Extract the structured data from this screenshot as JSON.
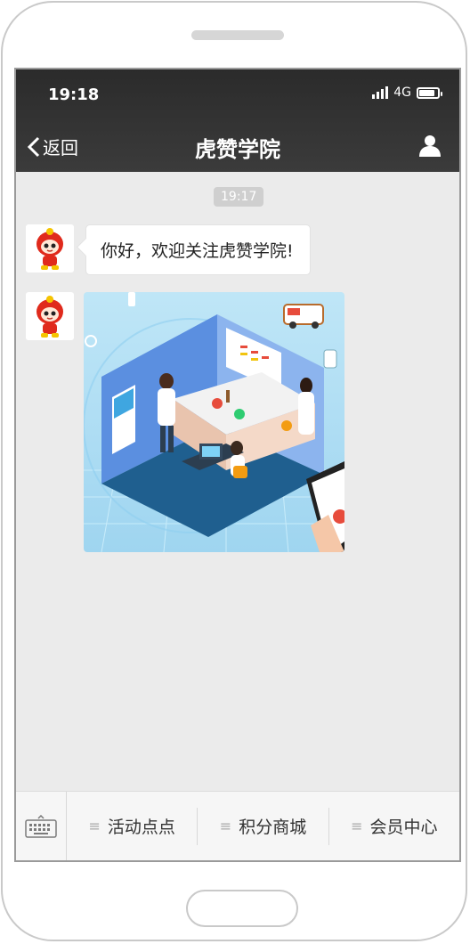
{
  "status": {
    "time": "19:18",
    "network": "4G"
  },
  "nav": {
    "back_label": "返回",
    "title": "虎赞学院"
  },
  "chat": {
    "timestamp": "19:17",
    "messages": [
      {
        "type": "text",
        "text": "你好，欢迎关注虎赞学院!"
      },
      {
        "type": "image"
      }
    ]
  },
  "menu": {
    "items": [
      {
        "label": "活动点点",
        "glyph": "≡"
      },
      {
        "label": "积分商城",
        "glyph": "≡"
      },
      {
        "label": "会员中心",
        "glyph": "≡"
      }
    ]
  },
  "colors": {
    "navbar": "#2f2f2f",
    "chat_bg": "#ebebeb",
    "mascot": "#e02a1c"
  },
  "icons": [
    "back-chevron-icon",
    "user-icon",
    "keyboard-icon",
    "mascot-avatar",
    "menu-lines-icon"
  ]
}
